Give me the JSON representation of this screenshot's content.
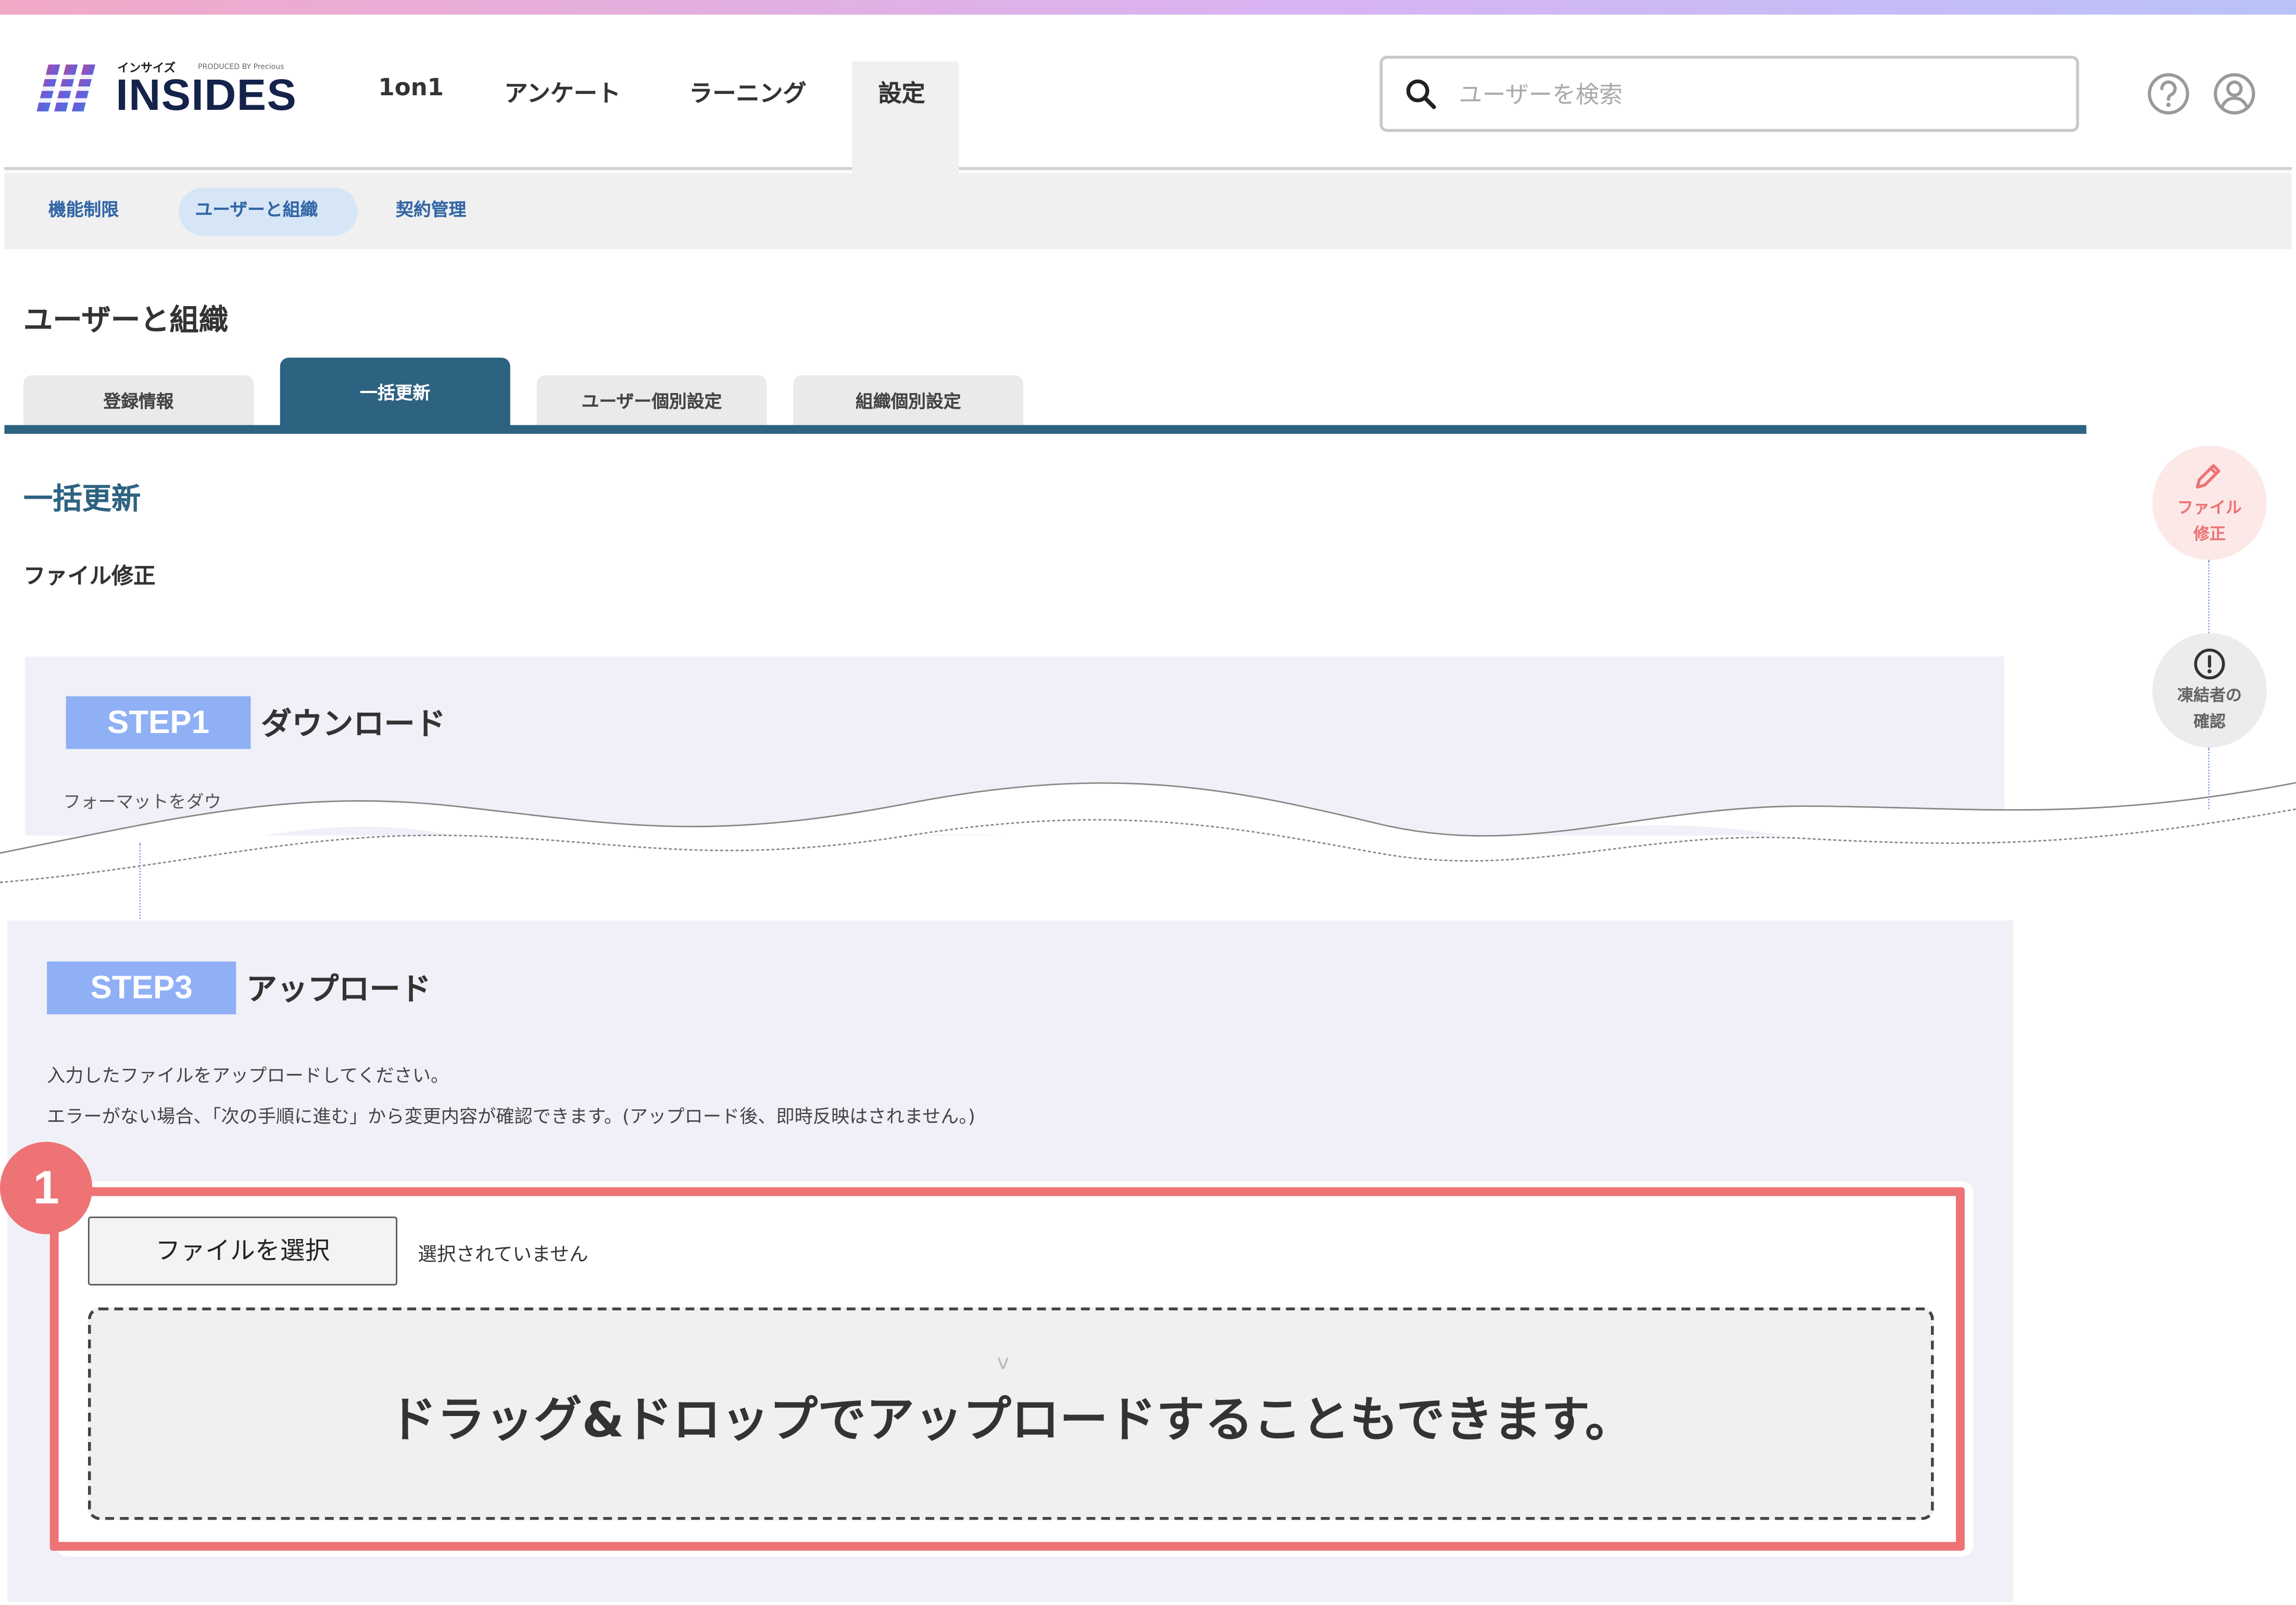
{
  "brand": {
    "kana": "インサイズ",
    "name": "INSIDES",
    "produced_by": "PRODUCED BY Precious"
  },
  "nav": {
    "items": [
      "1on1",
      "アンケート",
      "ラーニング",
      "設定"
    ],
    "active": "設定"
  },
  "search": {
    "placeholder": "ユーザーを検索",
    "value": ""
  },
  "header_icons": [
    "help-icon",
    "user-account-icon"
  ],
  "subnav": {
    "items": [
      "機能制限",
      "ユーザーと組織",
      "契約管理"
    ],
    "active": "ユーザーと組織"
  },
  "page": {
    "title": "ユーザーと組織"
  },
  "tabs": {
    "items": [
      "登録情報",
      "一括更新",
      "ユーザー個別設定",
      "組織個別設定"
    ],
    "active": "一括更新"
  },
  "section": {
    "title": "一括更新",
    "subtitle": "ファイル修正"
  },
  "step1": {
    "badge": "STEP1",
    "title": "ダウンロード",
    "description": "フォーマットをダウ"
  },
  "step3": {
    "badge": "STEP3",
    "title": "アップロード",
    "description_line1": "入力したファイルをアップロードしてください。",
    "description_line2": "エラーがない場合、「次の手順に進む」から変更内容が確認できます。(アップロード後、即時反映はされません。)"
  },
  "upload": {
    "file_button_label": "ファイルを選択",
    "file_status": "選択されていません",
    "dropzone_text": "ドラッグ&ドロップでアップロードすることもできます。",
    "dropzone_caret": "v"
  },
  "callout": {
    "number": "1"
  },
  "side_steps": [
    {
      "label_line1": "ファイル",
      "label_line2": "修正",
      "icon": "pencil-icon",
      "status": "current"
    },
    {
      "label_line1": "凍結者の",
      "label_line2": "確認",
      "icon": "exclamation-icon",
      "status": "pending"
    }
  ],
  "colors": {
    "accent": "#2e6281",
    "step_badge": "#8fb0f5",
    "highlight": "#ed7375",
    "subnav_link": "#3266a5",
    "side_step_current": "#ed7375"
  }
}
